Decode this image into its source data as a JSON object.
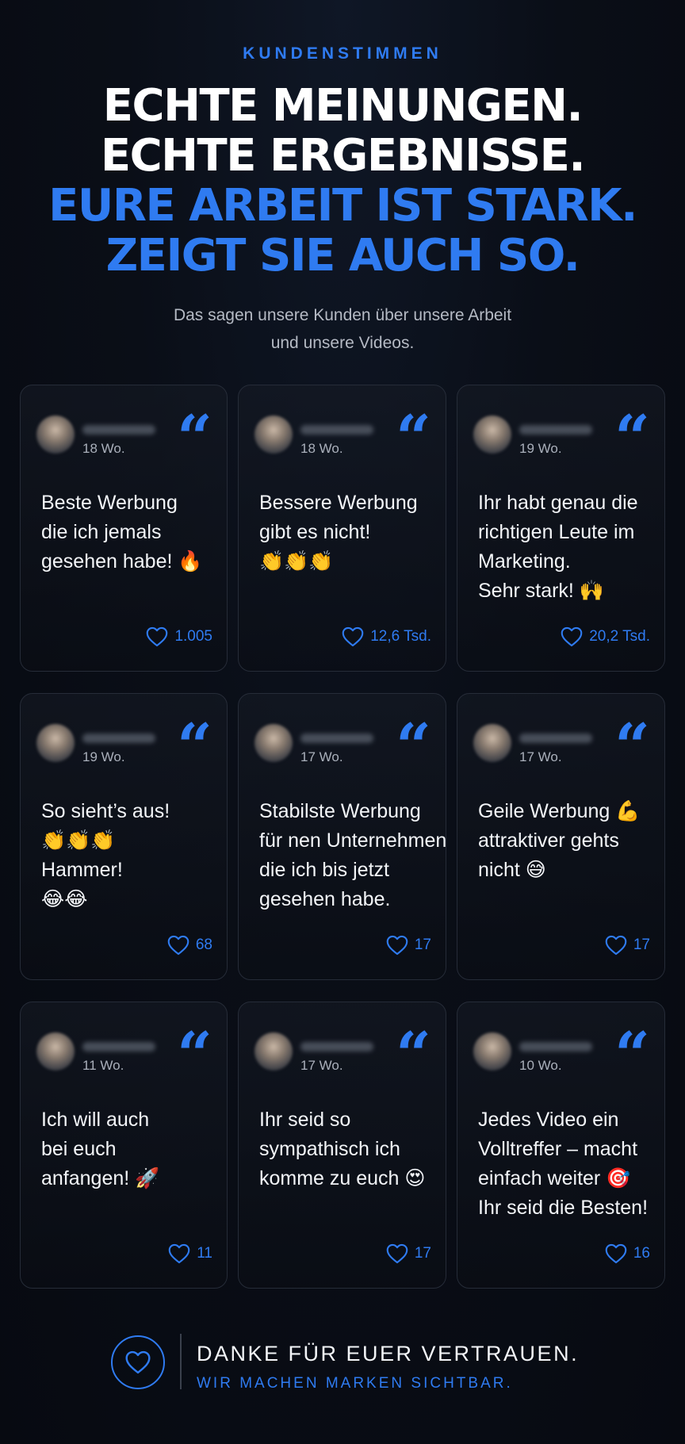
{
  "header": {
    "eyebrow": "KUNDENSTIMMEN",
    "headline_white": [
      "ECHTE MEINUNGEN.",
      "ECHTE ERGEBNISSE."
    ],
    "headline_blue": [
      "EURE ARBEIT IST STARK.",
      "ZEIGT SIE AUCH SO."
    ],
    "subtitle": [
      "Das sagen unsere Kunden über unsere Arbeit",
      "und unsere Videos."
    ]
  },
  "icons": {
    "quote": "“",
    "like": "heart-icon",
    "footer": "heart-icon"
  },
  "colors": {
    "accent": "#2f7bf1",
    "background": "#0a0e17",
    "card_border": "#262c38"
  },
  "testimonials": [
    {
      "age": "18 Wo.",
      "text": [
        "Beste Werbung",
        "die ich jemals",
        "gesehen habe! 🔥"
      ],
      "likes": "1.005"
    },
    {
      "age": "18 Wo.",
      "text": [
        "Bessere Werbung",
        "gibt es nicht!",
        "👏👏👏"
      ],
      "likes": "12,6 Tsd."
    },
    {
      "age": "19 Wo.",
      "text": [
        "Ihr habt genau die",
        "richtigen Leute im",
        "Marketing.",
        "Sehr stark! 🙌"
      ],
      "likes": "20,2 Tsd."
    },
    {
      "age": "19 Wo.",
      "text": [
        "So sieht’s aus!",
        "👏👏👏",
        "Hammer!",
        "😂😂"
      ],
      "likes": "68"
    },
    {
      "age": "17 Wo.",
      "text": [
        "Stabilste Werbung",
        "für nen Unternehmen",
        "die ich bis jetzt",
        "gesehen habe."
      ],
      "likes": "17"
    },
    {
      "age": "17 Wo.",
      "text": [
        "Geile Werbung 💪",
        "attraktiver gehts",
        "nicht 😅"
      ],
      "likes": "17"
    },
    {
      "age": "11 Wo.",
      "text": [
        "Ich will auch",
        "bei euch",
        "anfangen! 🚀"
      ],
      "likes": "11"
    },
    {
      "age": "17 Wo.",
      "text": [
        "Ihr seid so",
        "sympathisch ich",
        "komme zu euch 😍"
      ],
      "likes": "17"
    },
    {
      "age": "10 Wo.",
      "text": [
        "Jedes Video ein",
        "Volltreffer – macht",
        "einfach weiter 🎯",
        "Ihr seid die Besten!"
      ],
      "likes": "16"
    }
  ],
  "footer": {
    "title": "DANKE FÜR EUER VERTRAUEN.",
    "subtitle": "WIR MACHEN MARKEN SICHTBAR."
  }
}
